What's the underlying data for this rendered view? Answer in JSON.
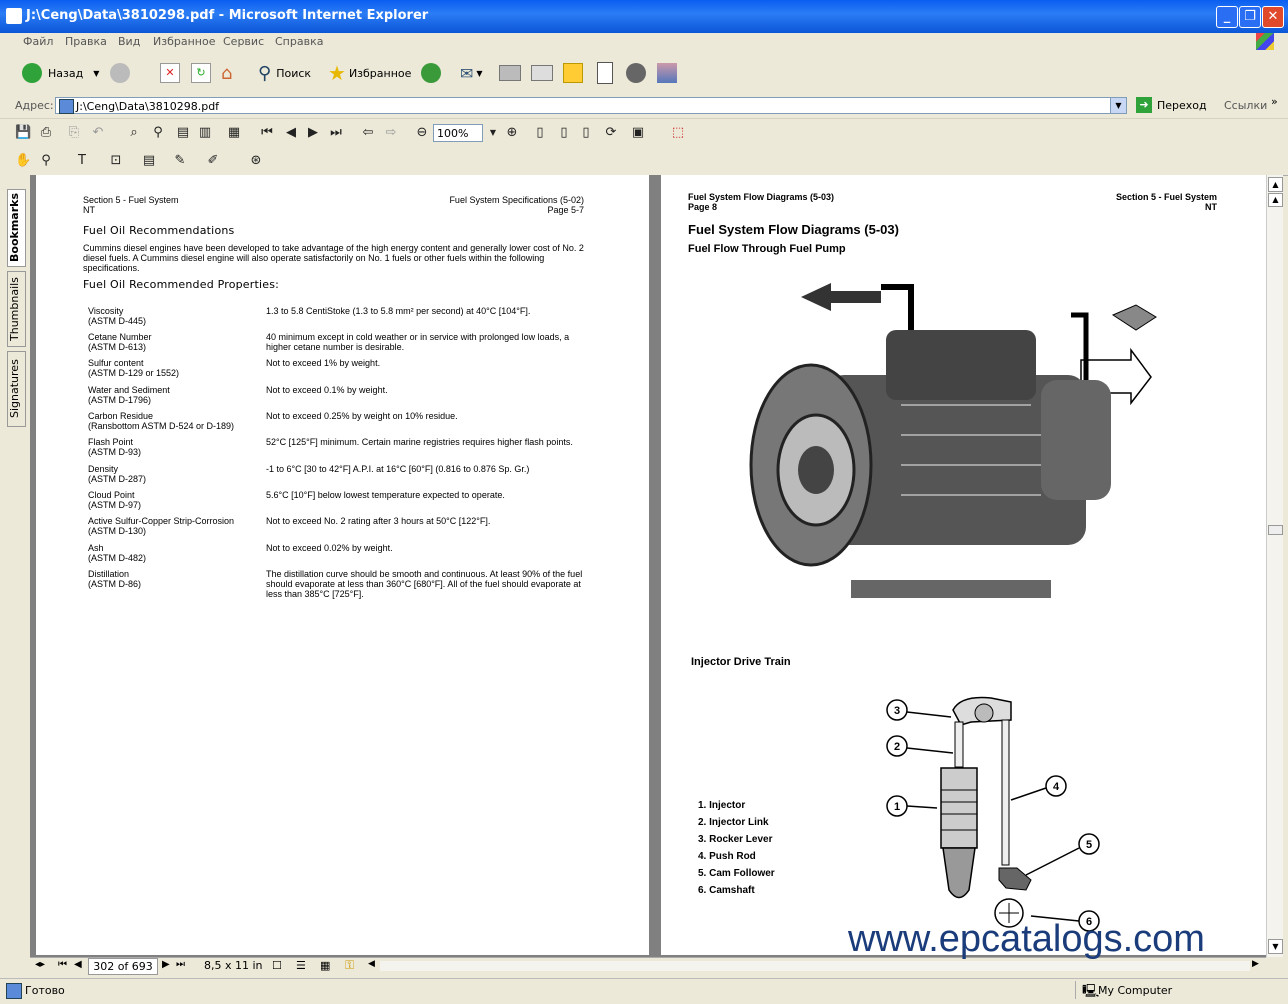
{
  "window": {
    "title": "J:\\Ceng\\Data\\3810298.pdf - Microsoft Internet Explorer"
  },
  "menu": [
    "Файл",
    "Правка",
    "Вид",
    "Избранное",
    "Сервис",
    "Справка"
  ],
  "toolbar": {
    "back": "Назад",
    "search": "Поиск",
    "favorites": "Избранное"
  },
  "address": {
    "label": "Адрес:",
    "value": "J:\\Ceng\\Data\\3810298.pdf",
    "go": "Переход",
    "links": "Ссылки"
  },
  "reader": {
    "zoom": "100%",
    "page_indicator": "302 of 693",
    "page_size": "8,5 x 11 in"
  },
  "sidetabs": [
    "Bookmarks",
    "Thumbnails",
    "Signatures"
  ],
  "left_page": {
    "header_left_1": "Section 5 - Fuel System",
    "header_left_2": "NT",
    "header_right_1": "Fuel System Specifications (5-02)",
    "header_right_2": "Page 5-7",
    "title": "Fuel Oil Recommendations",
    "intro": "Cummins diesel engines have been developed to take advantage of the high energy content and generally lower cost of No. 2 diesel fuels. A Cummins diesel engine will also operate satisfactorily on No. 1 fuels or other fuels within the following specifications.",
    "subtitle": "Fuel Oil Recommended Properties:",
    "specs": [
      {
        "name": "Viscosity",
        "std": "(ASTM D-445)",
        "value": "1.3 to 5.8 CentiStoke (1.3 to 5.8 mm² per second) at 40°C [104°F]."
      },
      {
        "name": "Cetane Number",
        "std": "(ASTM D-613)",
        "value": "40 minimum except in cold weather or in service with prolonged low loads, a higher cetane number is desirable."
      },
      {
        "name": "Sulfur content",
        "std": "(ASTM D-129 or 1552)",
        "value": "Not to exceed 1% by weight."
      },
      {
        "name": "Water and Sediment",
        "std": "(ASTM D-1796)",
        "value": "Not to exceed 0.1% by weight."
      },
      {
        "name": "Carbon Residue",
        "std": "(Ransbottom ASTM D-524 or D-189)",
        "value": "Not to exceed 0.25% by weight on 10% residue."
      },
      {
        "name": "Flash Point",
        "std": "(ASTM D-93)",
        "value": "52°C [125°F] minimum. Certain marine registries requires higher flash points."
      },
      {
        "name": "Density",
        "std": "(ASTM D-287)",
        "value": "-1 to 6°C [30 to 42°F] A.P.I. at 16°C [60°F] (0.816 to 0.876 Sp. Gr.)"
      },
      {
        "name": "Cloud Point",
        "std": "(ASTM D-97)",
        "value": "5.6°C [10°F] below lowest temperature expected to operate."
      },
      {
        "name": "Active Sulfur-Copper Strip-Corrosion",
        "std": "(ASTM D-130)",
        "value": "Not to exceed No. 2 rating after 3 hours at 50°C [122°F]."
      },
      {
        "name": "Ash",
        "std": "(ASTM D-482)",
        "value": "Not to exceed 0.02% by weight."
      },
      {
        "name": "Distillation",
        "std": "(ASTM D-86)",
        "value": "The distillation curve should be smooth and continuous. At least 90% of the fuel should evaporate at less than 360°C [680°F]. All of the fuel should evaporate at less than 385°C [725°F]."
      }
    ]
  },
  "right_page": {
    "header_left_1": "Fuel System Flow Diagrams (5-03)",
    "header_left_2": "Page  8",
    "header_right_1": "Section 5 - Fuel System",
    "header_right_2": "NT",
    "title": "Fuel System Flow Diagrams (5-03)",
    "subtitle": "Fuel Flow Through Fuel Pump",
    "section2": "Injector Drive Train",
    "parts": [
      "1. Injector",
      "2. Injector Link",
      "3. Rocker Lever",
      "4. Push Rod",
      "5. Cam Follower",
      "6. Camshaft"
    ],
    "callouts": [
      "1",
      "2",
      "3",
      "4",
      "5",
      "6"
    ]
  },
  "watermark": "www.epcatalogs.com",
  "status": {
    "left": "Готово",
    "right": "My Computer"
  }
}
